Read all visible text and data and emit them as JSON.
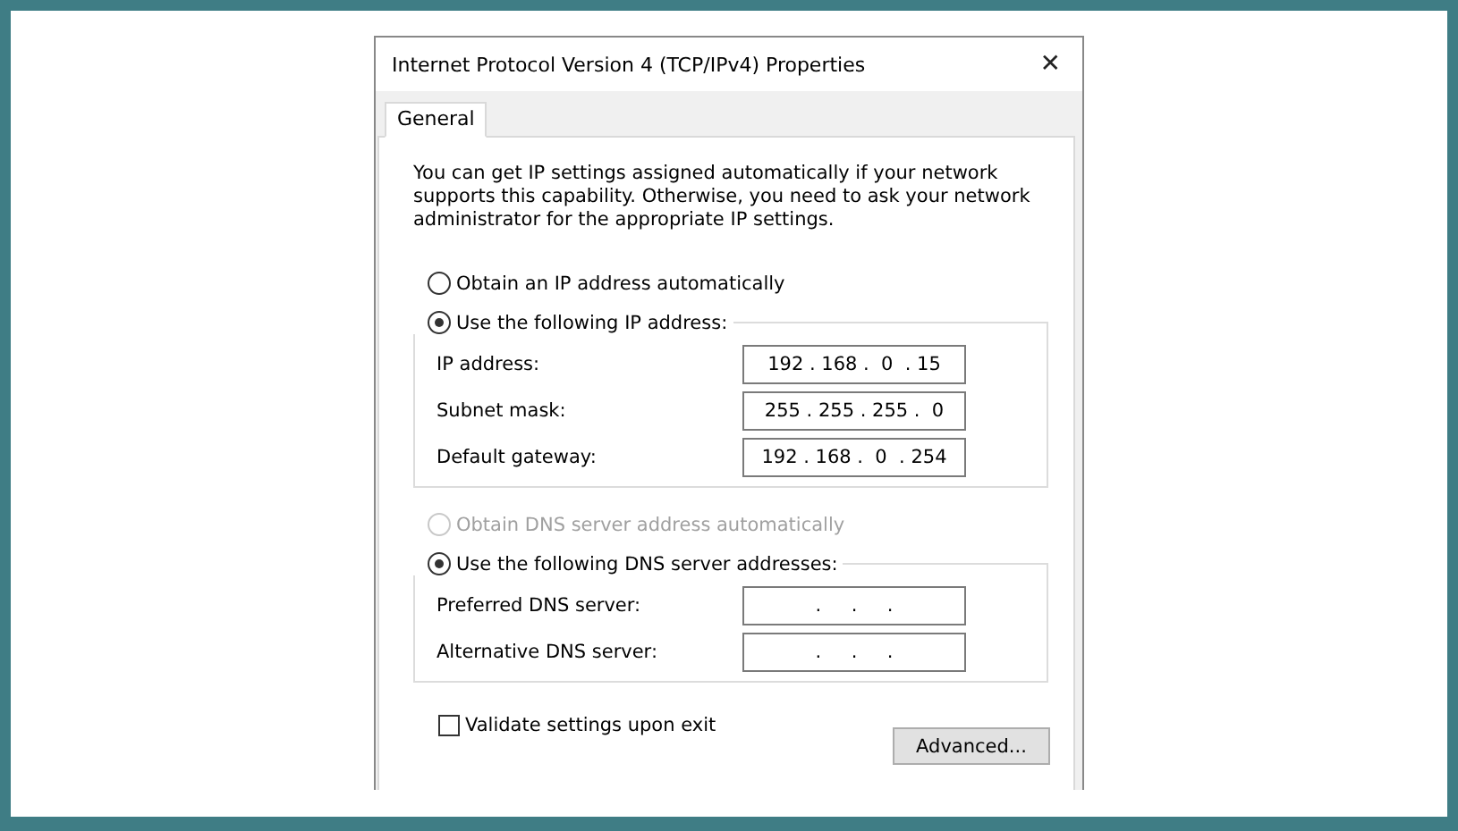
{
  "window": {
    "title": "Internet Protocol Version 4 (TCP/IPv4) Properties",
    "close": "✕"
  },
  "tabs": [
    {
      "label": "General",
      "selected": true
    }
  ],
  "intro": "You can get IP settings assigned automatically if your network supports this capability. Otherwise, you need to ask your network administrator for the appropriate IP settings.",
  "ip_options": [
    {
      "label": "Obtain an IP address automatically",
      "selected": false,
      "disabled": false
    },
    {
      "label": "Use the following IP address:",
      "selected": true,
      "disabled": false
    }
  ],
  "ip_fields": [
    {
      "label": "IP address:",
      "value": "192 . 168 .  0  . 15"
    },
    {
      "label": "Subnet mask:",
      "value": "255 . 255 . 255 .  0"
    },
    {
      "label": "Default gateway:",
      "value": "192 . 168 .  0  . 254"
    }
  ],
  "dns_options": [
    {
      "label": "Obtain DNS server address automatically",
      "selected": false,
      "disabled": true
    },
    {
      "label": "Use the following DNS server addresses:",
      "selected": true,
      "disabled": false
    }
  ],
  "dns_fields": [
    {
      "label": "Preferred DNS server:",
      "value": ".     .     ."
    },
    {
      "label": "Alternative DNS server:",
      "value": ".     .     ."
    }
  ],
  "validate": {
    "label": "Validate settings upon exit",
    "checked": false
  },
  "advanced_button": "Advanced..."
}
